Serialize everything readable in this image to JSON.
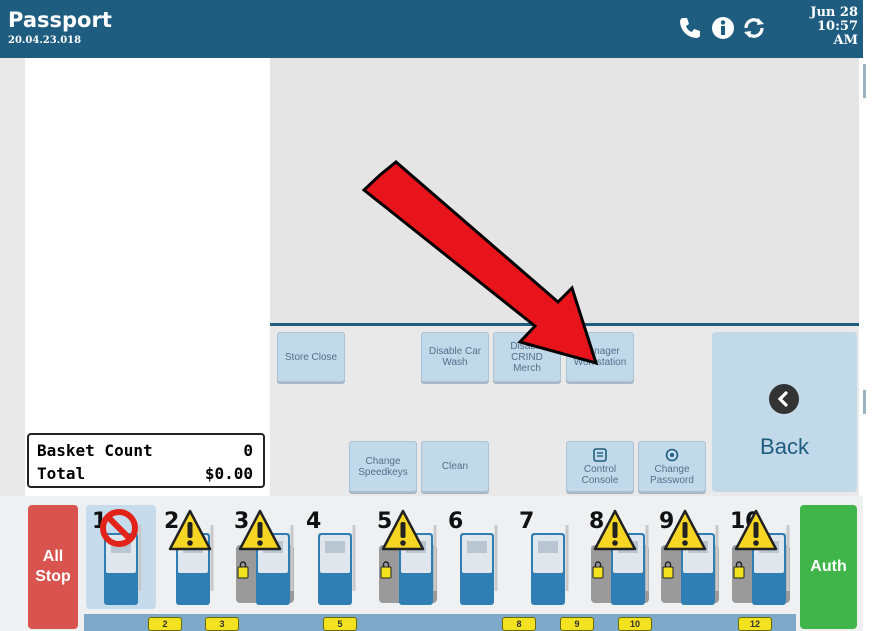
{
  "header": {
    "title": "Passport",
    "version": "20.04.23.018",
    "date": "Jun 28",
    "time": "10:57",
    "ampm": "AM",
    "icons": [
      "phone-icon",
      "info-icon",
      "refresh-icon"
    ]
  },
  "totals": {
    "basket_label": "Basket Count",
    "basket_value": "0",
    "total_label": "Total",
    "total_value": "$0.00"
  },
  "buttons": {
    "store_close": "Store Close",
    "disable_car_wash": [
      "Disable Car",
      "Wash"
    ],
    "disable_crind_merch": [
      "Disable CRIND",
      "Merch"
    ],
    "manager_workstation": [
      "Manager",
      "Workstation"
    ],
    "change_speedkeys": [
      "Change",
      "Speedkeys"
    ],
    "clean": "Clean",
    "control_console": [
      "Control",
      "Console"
    ],
    "change_password": [
      "Change",
      "Password"
    ],
    "back": "Back"
  },
  "pump_bar": {
    "all_stop": [
      "All",
      "Stop"
    ],
    "auth": "Auth",
    "pumps": [
      {
        "num": "1",
        "status": "stopped"
      },
      {
        "num": "2",
        "status": "warning"
      },
      {
        "num": "3",
        "status": "warning",
        "locked": true
      },
      {
        "num": "4",
        "status": "idle"
      },
      {
        "num": "5",
        "status": "warning",
        "locked": true
      },
      {
        "num": "6",
        "status": "idle"
      },
      {
        "num": "7",
        "status": "idle"
      },
      {
        "num": "8",
        "status": "warning",
        "locked": true
      },
      {
        "num": "9",
        "status": "warning",
        "locked": true
      },
      {
        "num": "10",
        "status": "warning",
        "locked": true
      }
    ],
    "tags": [
      "2",
      "3",
      "5",
      "8",
      "9",
      "10",
      "12"
    ]
  },
  "colors": {
    "header": "#1f5d80",
    "button": "#c2d9ea",
    "all_stop": "#d9534f",
    "auth": "#3fb54a",
    "annotation_arrow": "#e8141b"
  }
}
